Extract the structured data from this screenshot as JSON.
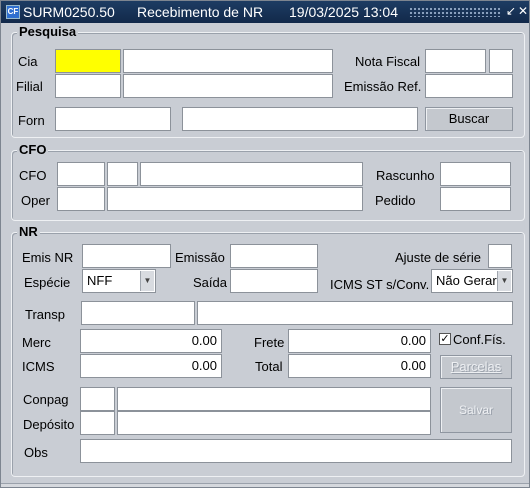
{
  "titlebar": {
    "code": "SURM0250.50",
    "title": "Recebimento de NR",
    "datetime": "19/03/2025 13:04",
    "icon": "form-icon"
  },
  "pesquisa": {
    "title": "Pesquisa",
    "cia_label": "Cia",
    "filial_label": "Filial",
    "forn_label": "Forn",
    "nota_fiscal_label": "Nota Fiscal",
    "emissao_ref_label": "Emissão Ref.",
    "buscar_label": "Buscar"
  },
  "cfo": {
    "title": "CFO",
    "cfo_label": "CFO",
    "oper_label": "Oper",
    "rascunho_label": "Rascunho",
    "pedido_label": "Pedido"
  },
  "nr": {
    "title": "NR",
    "emis_nr_label": "Emis NR",
    "emissao_label": "Emissão",
    "ajuste_serie_label": "Ajuste de série",
    "especie_label": "Espécie",
    "especie_value": "NFF",
    "saida_label": "Saída",
    "icms_st_label": "ICMS ST s/Conv.",
    "icms_st_value": "Não Gerar",
    "transp_label": "Transp",
    "merc_label": "Merc",
    "merc_value": "0.00",
    "frete_label": "Frete",
    "frete_value": "0.00",
    "conf_fis_label": "Conf.Fís.",
    "conf_fis_checked": true,
    "icms_label": "ICMS",
    "icms_value": "0.00",
    "total_label": "Total",
    "total_value": "0.00",
    "parcelas_label": "Parcelas",
    "conpag_label": "Conpag",
    "deposito_label": "Depósito",
    "salvar_label": "Salvar",
    "obs_label": "Obs"
  }
}
